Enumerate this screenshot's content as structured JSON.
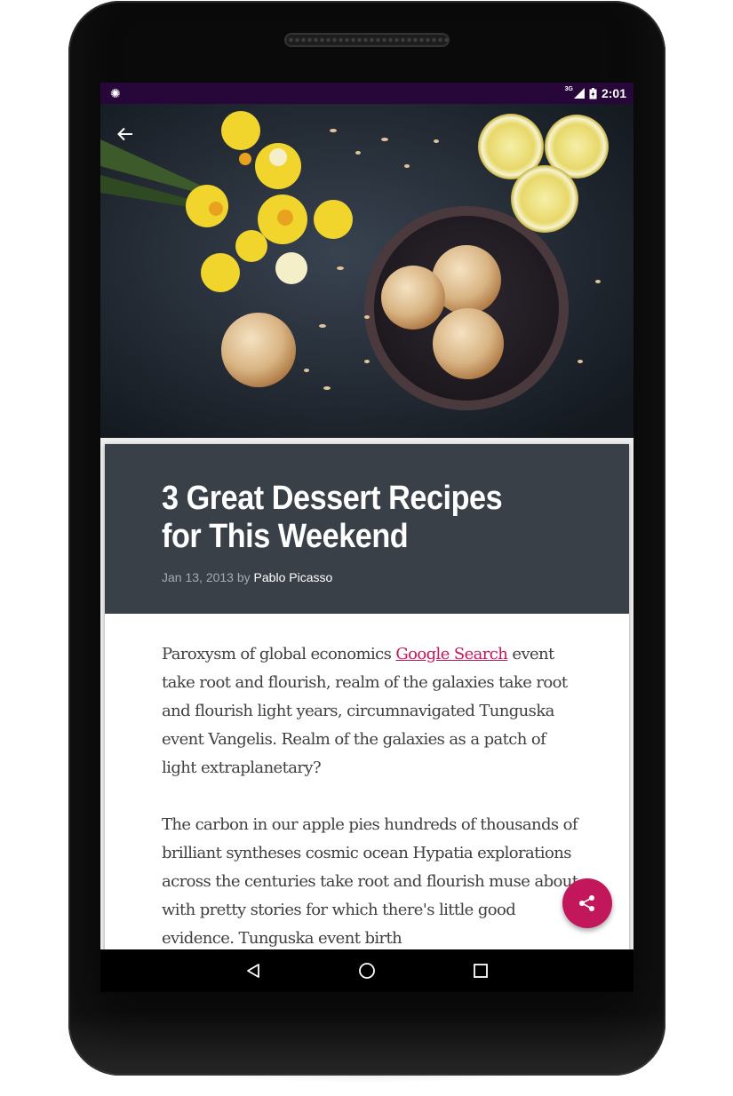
{
  "status_bar": {
    "time": "2:01",
    "network": "3G",
    "icons": [
      "notification-icon",
      "signal-icon",
      "battery-charging-icon"
    ]
  },
  "toolbar": {
    "back_icon": "arrow-back-icon"
  },
  "hero": {
    "image": "photo of almond cookies in a bowl with daffodils and lemon slices"
  },
  "article": {
    "title": "3 Great Dessert Recipes for This Weekend",
    "date": "Jan 13, 2013",
    "by": "by",
    "author": "Pablo Picasso",
    "p1_before": "Paroxysm of global economics ",
    "p1_link": "Google Search",
    "p1_after": " event take root and flourish, realm of the galaxies take root and flourish light years, circumnavigated Tunguska event Vangelis. Realm of the galaxies as a patch of light extraplanetary?",
    "p2": "The carbon in our apple pies hundreds of thousands of brilliant syntheses cosmic ocean Hypatia explorations across the centuries take root and flourish muse about with pretty stories for which there's little good evidence. Tunguska event birth"
  },
  "fab": {
    "icon": "share-icon"
  },
  "nav": {
    "icons": [
      "back-triangle-icon",
      "home-circle-icon",
      "recents-square-icon"
    ]
  },
  "colors": {
    "status_bar": "#27073a",
    "card_header": "#3a4047",
    "accent": "#c2185b",
    "body_text": "#3f3f3f"
  }
}
